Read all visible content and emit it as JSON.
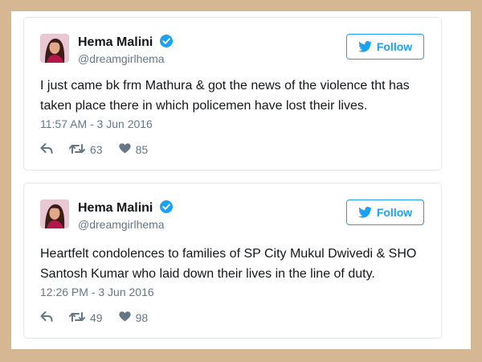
{
  "colors": {
    "background": "#d5b893",
    "card_border": "#e1e8ed",
    "accent": "#1da1f2",
    "text": "#14171a",
    "muted": "#657786"
  },
  "tweets": [
    {
      "name": "Hema Malini",
      "handle": "@dreamgirlhema",
      "follow_label": "Follow",
      "text": "I just came bk frm Mathura & got the news of the violence tht has taken place there in which policemen have lost their lives.",
      "time": "11:57 AM - 3 Jun 2016",
      "retweets": "63",
      "likes": "85",
      "icons": [
        "verified-icon",
        "twitter-bird-icon",
        "reply-icon",
        "retweet-icon",
        "like-icon"
      ]
    },
    {
      "name": "Hema Malini",
      "handle": "@dreamgirlhema",
      "follow_label": "Follow",
      "text": "Heartfelt condolences to families of SP City Mukul Dwivedi & SHO Santosh Kumar who laid down their lives in the line of duty.",
      "time": "12:26 PM - 3 Jun 2016",
      "retweets": "49",
      "likes": "98",
      "icons": [
        "verified-icon",
        "twitter-bird-icon",
        "reply-icon",
        "retweet-icon",
        "like-icon"
      ]
    }
  ]
}
